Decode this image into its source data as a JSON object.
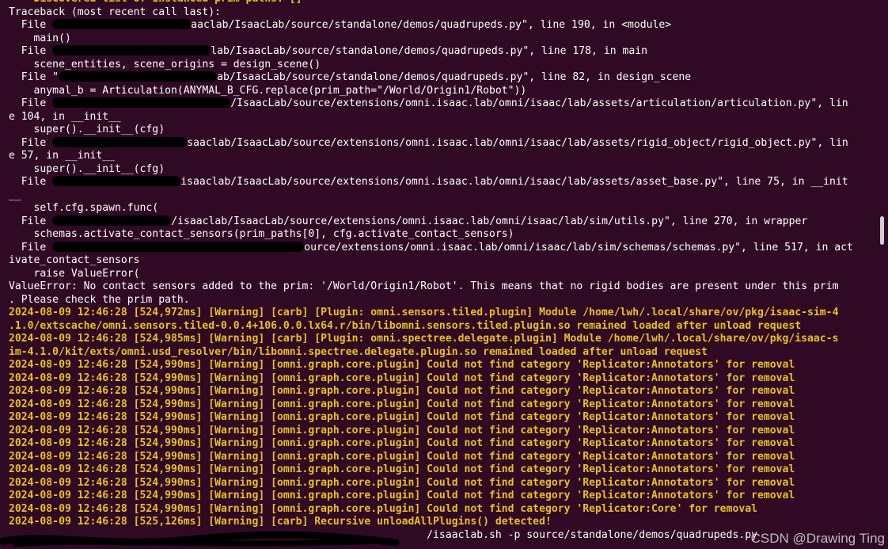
{
  "window": {
    "background": "#300a24",
    "text_color": "#ffffff",
    "warning_color": "#e8c11c",
    "watermark": "CSDN @Drawing Ting"
  },
  "lines": [
    {
      "text": "    Discovered list of instanced prim paths: []",
      "warn": true
    },
    {
      "text": "Traceback (most recent call last):"
    },
    {
      "text": "  File ",
      "redact": 175,
      "text2": "aaclab/IsaacLab/source/standalone/demos/quadrupeds.py\", line 190, in <module>"
    },
    {
      "text": "    main()"
    },
    {
      "text": "  File ",
      "redact": 200,
      "text2": "lab/IsaacLab/source/standalone/demos/quadrupeds.py\", line 178, in main"
    },
    {
      "text": "    scene_entities, scene_origins = design_scene()"
    },
    {
      "text": "  File \"",
      "redact": 200,
      "text2": "ab/IsaacLab/source/standalone/demos/quadrupeds.py\", line 82, in design_scene"
    },
    {
      "text": "    anymal_b = Articulation(ANYMAL_B_CFG.replace(prim_path=\"/World/Origin1/Robot\"))"
    },
    {
      "text": "  File ",
      "redact": 225,
      "text2": "/IsaacLab/source/extensions/omni.isaac.lab/omni/isaac/lab/assets/articulation/articulation.py\", lin"
    },
    {
      "text": "e 104, in __init__"
    },
    {
      "text": "    super().__init__(cfg)"
    },
    {
      "text": "  File ",
      "redact": 170,
      "text2": "saaclab/IsaacLab/source/extensions/omni.isaac.lab/omni/isaac/lab/assets/rigid_object/rigid_object.py\", lin"
    },
    {
      "text": "e 57, in __init__"
    },
    {
      "text": "    super().__init__(cfg)"
    },
    {
      "text": "  File ",
      "redact": 162,
      "text2": "isaaclab/IsaacLab/source/extensions/omni.isaac.lab/omni/isaac/lab/assets/asset_base.py\", line 75, in __init"
    },
    {
      "text": "__"
    },
    {
      "text": "    self.cfg.spawn.func("
    },
    {
      "text": "  File ",
      "redact": 150,
      "text2": "/isaaclab/IsaacLab/source/extensions/omni.isaac.lab/omni/isaac/lab/sim/utils.py\", line 270, in wrapper"
    },
    {
      "text": "    schemas.activate_contact_sensors(prim_paths[0], cfg.activate_contact_sensors)"
    },
    {
      "text": "  File ",
      "redact": 318,
      "text2": "ource/extensions/omni.isaac.lab/omni/isaac/lab/sim/schemas/schemas.py\", line 517, in act"
    },
    {
      "text": "ivate_contact_sensors"
    },
    {
      "text": "    raise ValueError("
    },
    {
      "text": "ValueError: No contact sensors added to the prim: '/World/Origin1/Robot'. This means that no rigid bodies are present under this prim"
    },
    {
      "text": ". Please check the prim path."
    },
    {
      "text": "2024-08-09 12:46:28 [524,972ms] [Warning] [carb] [Plugin: omni.sensors.tiled.plugin] Module /home/lwh/.local/share/ov/pkg/isaac-sim-4",
      "warn": true
    },
    {
      "text": ".1.0/extscache/omni.sensors.tiled-0.0.4+106.0.0.lx64.r/bin/libomni.sensors.tiled.plugin.so remained loaded after unload request",
      "warn": true
    },
    {
      "text": "2024-08-09 12:46:28 [524,985ms] [Warning] [carb] [Plugin: omni.spectree.delegate.plugin] Module /home/lwh/.local/share/ov/pkg/isaac-s",
      "warn": true
    },
    {
      "text": "im-4.1.0/kit/exts/omni.usd_resolver/bin/libomni.spectree.delegate.plugin.so remained loaded after unload request",
      "warn": true
    },
    {
      "text": "2024-08-09 12:46:28 [524,990ms] [Warning] [omni.graph.core.plugin] Could not find category 'Replicator:Annotators' for removal",
      "warn": true
    },
    {
      "text": "2024-08-09 12:46:28 [524,990ms] [Warning] [omni.graph.core.plugin] Could not find category 'Replicator:Annotators' for removal",
      "warn": true
    },
    {
      "text": "2024-08-09 12:46:28 [524,990ms] [Warning] [omni.graph.core.plugin] Could not find category 'Replicator:Annotators' for removal",
      "warn": true
    },
    {
      "text": "2024-08-09 12:46:28 [524,990ms] [Warning] [omni.graph.core.plugin] Could not find category 'Replicator:Annotators' for removal",
      "warn": true
    },
    {
      "text": "2024-08-09 12:46:28 [524,990ms] [Warning] [omni.graph.core.plugin] Could not find category 'Replicator:Annotators' for removal",
      "warn": true
    },
    {
      "text": "2024-08-09 12:46:28 [524,990ms] [Warning] [omni.graph.core.plugin] Could not find category 'Replicator:Annotators' for removal",
      "warn": true
    },
    {
      "text": "2024-08-09 12:46:28 [524,990ms] [Warning] [omni.graph.core.plugin] Could not find category 'Replicator:Annotators' for removal",
      "warn": true
    },
    {
      "text": "2024-08-09 12:46:28 [524,990ms] [Warning] [omni.graph.core.plugin] Could not find category 'Replicator:Annotators' for removal",
      "warn": true
    },
    {
      "text": "2024-08-09 12:46:28 [524,990ms] [Warning] [omni.graph.core.plugin] Could not find category 'Replicator:Annotators' for removal",
      "warn": true
    },
    {
      "text": "2024-08-09 12:46:28 [524,990ms] [Warning] [omni.graph.core.plugin] Could not find category 'Replicator:Annotators' for removal",
      "warn": true
    },
    {
      "text": "2024-08-09 12:46:28 [524,990ms] [Warning] [omni.graph.core.plugin] Could not find category 'Replicator:Annotators' for removal",
      "warn": true
    },
    {
      "text": "2024-08-09 12:46:28 [524,990ms] [Warning] [omni.graph.core.plugin] Could not find category 'Replicator:Core' for removal",
      "warn": true
    },
    {
      "text": "2024-08-09 12:46:28 [525,126ms] [Warning] [carb] Recursive unloadAllPlugins() detected!",
      "warn": true
    },
    {
      "text": "                                                                   /isaaclab.sh -p source/standalone/demos/quadrupeds.py"
    }
  ]
}
